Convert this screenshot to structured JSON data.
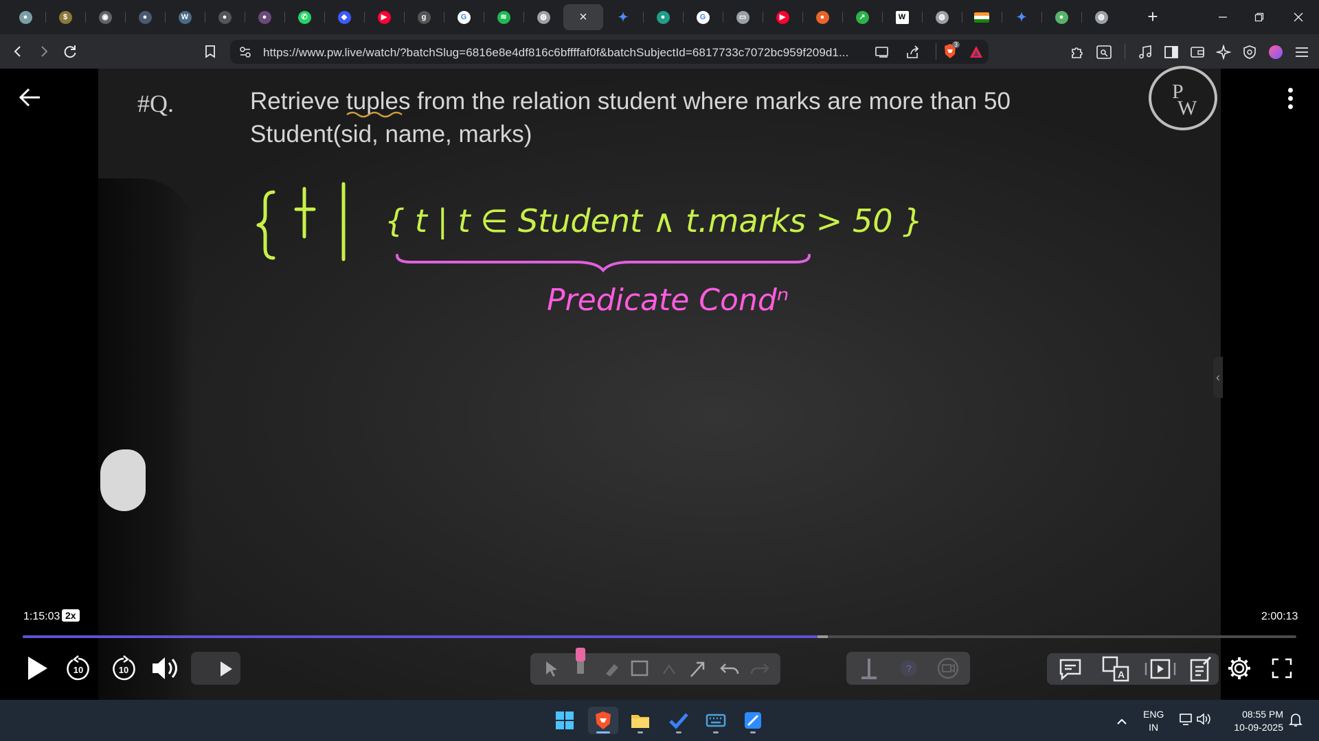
{
  "browser": {
    "tabs": [
      {
        "icon": "app-icon",
        "color": "#7a9ea6"
      },
      {
        "icon": "coin-icon",
        "color": "#8a7a3a"
      },
      {
        "icon": "github-icon",
        "color": "#606367"
      },
      {
        "icon": "app-icon",
        "color": "#4a5a70"
      },
      {
        "icon": "w3schools-icon",
        "color": "#4a6a88"
      },
      {
        "icon": "app-icon",
        "color": "#555"
      },
      {
        "icon": "app-icon",
        "color": "#6a4a7a"
      },
      {
        "icon": "whatsapp-icon",
        "color": "#25d366"
      },
      {
        "icon": "flag-icon",
        "color": "#3d5afe"
      },
      {
        "icon": "youtube-icon",
        "color": "#ff0033"
      },
      {
        "icon": "gfg-icon",
        "color": "#555"
      },
      {
        "icon": "google-icon",
        "color": "#ffffff"
      },
      {
        "icon": "spotify-icon",
        "color": "#1db954"
      },
      {
        "icon": "globe-icon",
        "color": "#9aa0a6"
      },
      {
        "icon": "close-icon",
        "color": "#3c3d41",
        "active": true
      },
      {
        "icon": "gemini-icon",
        "color": "#4c8df6"
      },
      {
        "icon": "app-icon",
        "color": "#1f9e8a"
      },
      {
        "icon": "google-icon",
        "color": "#ffffff"
      },
      {
        "icon": "screen-icon",
        "color": "#9aa0a6"
      },
      {
        "icon": "youtube-icon",
        "color": "#ff0033"
      },
      {
        "icon": "app-icon",
        "color": "#e8642a"
      },
      {
        "icon": "chart-icon",
        "color": "#2bb24c"
      },
      {
        "icon": "wikipedia-icon",
        "color": "#ffffff"
      },
      {
        "icon": "globe-icon",
        "color": "#9aa0a6"
      },
      {
        "icon": "india-flag-icon",
        "color": "#ff9933"
      },
      {
        "icon": "gemini-icon",
        "color": "#4c8df6"
      },
      {
        "icon": "app-icon",
        "color": "#5ab26a"
      },
      {
        "icon": "globe-icon",
        "color": "#9aa0a6"
      }
    ],
    "active_tab_close_glyph": "×",
    "new_tab_glyph": "+",
    "url": "https://www.pw.live/watch/?batchSlug=6816e8e4df816c6bffffaf0f&batchSubjectId=6817733c7072bc959f209d1...",
    "brave_shield_badge": "3"
  },
  "board": {
    "question_number": "#Q.",
    "question_text": "Retrieve tuples from the relation student where marks are more than 50",
    "schema_text": "Student(sid, name, marks)",
    "handwriting_expression": "{ t | t ∈ Student ∧ t.marks > 50 }",
    "handwriting_annotation": "Predicate Condⁿ",
    "logo_text": "PW",
    "colors": {
      "expression": "#c8f04a",
      "annotation": "#ff5ce0",
      "brace": "#e060e0"
    }
  },
  "player": {
    "current_time": "1:15:03",
    "speed": "2x",
    "total_time": "2:00:13",
    "progress_fraction": 0.624,
    "buffered_fraction": 0.008,
    "rewind_seconds": "10",
    "forward_seconds": "10",
    "accent_color": "#5b54d6"
  },
  "taskbar": {
    "apps": [
      "windows-start-icon",
      "brave-browser-icon",
      "file-explorer-icon",
      "todo-icon",
      "keyboard-icon",
      "paint-icon"
    ],
    "language_line1": "ENG",
    "language_line2": "IN",
    "time": "08:55 PM",
    "date": "10-09-2025"
  }
}
